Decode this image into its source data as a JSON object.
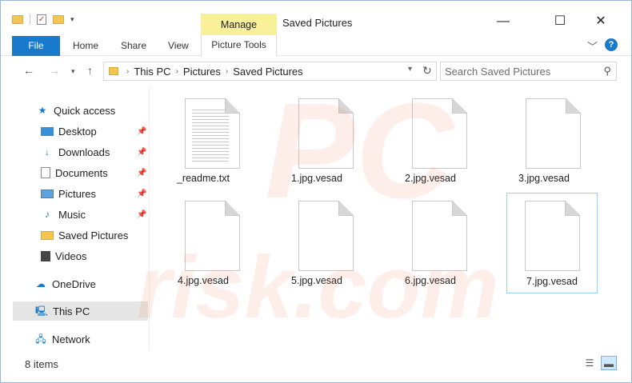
{
  "titlebar": {
    "manage_tab": "Manage",
    "window_title": "Saved Pictures",
    "minimize": "—",
    "maximize": "☐",
    "close": "✕"
  },
  "ribbon": {
    "file": "File",
    "tabs": [
      "Home",
      "Share",
      "View"
    ],
    "picture_tools": "Picture Tools",
    "help": "?"
  },
  "nav": {
    "breadcrumbs": [
      "This PC",
      "Pictures",
      "Saved Pictures"
    ],
    "search_placeholder": "Search Saved Pictures"
  },
  "sidebar": {
    "quick_access": "Quick access",
    "quick_items": [
      {
        "label": "Desktop",
        "icon": "desktop-icon",
        "pinned": true
      },
      {
        "label": "Downloads",
        "icon": "download-arrow-icon",
        "pinned": true
      },
      {
        "label": "Documents",
        "icon": "documents-icon",
        "pinned": true
      },
      {
        "label": "Pictures",
        "icon": "pictures-icon",
        "pinned": true
      },
      {
        "label": "Music",
        "icon": "music-note-icon",
        "pinned": true
      },
      {
        "label": "Saved Pictures",
        "icon": "folder-icon",
        "pinned": false
      },
      {
        "label": "Videos",
        "icon": "video-icon",
        "pinned": false
      }
    ],
    "onedrive": "OneDrive",
    "this_pc": "This PC",
    "network": "Network"
  },
  "files": [
    {
      "name": "_readme.txt",
      "type": "text"
    },
    {
      "name": "1.jpg.vesad",
      "type": "blank"
    },
    {
      "name": "2.jpg.vesad",
      "type": "blank"
    },
    {
      "name": "3.jpg.vesad",
      "type": "blank"
    },
    {
      "name": "4.jpg.vesad",
      "type": "blank"
    },
    {
      "name": "5.jpg.vesad",
      "type": "blank"
    },
    {
      "name": "6.jpg.vesad",
      "type": "blank"
    },
    {
      "name": "7.jpg.vesad",
      "type": "blank"
    }
  ],
  "status": {
    "item_count": "8 items"
  },
  "colors": {
    "accent": "#1979ca",
    "manage_highlight": "#f9f19a",
    "folder": "#f1c652",
    "selection": "#e5e5e5"
  }
}
